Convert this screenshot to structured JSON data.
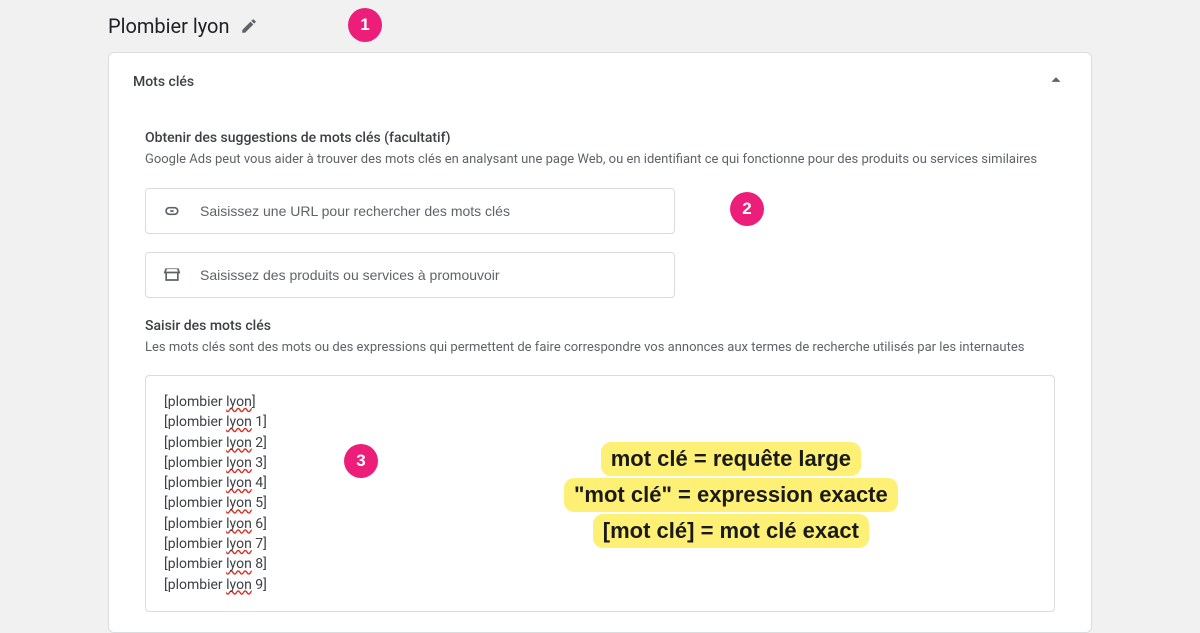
{
  "header": {
    "title": "Plombier lyon"
  },
  "card": {
    "title": "Mots clés"
  },
  "suggestions": {
    "title": "Obtenir des suggestions de mots clés (facultatif)",
    "desc": "Google Ads peut vous aider à trouver des mots clés en analysant une page Web, ou en identifiant ce qui fonctionne pour des produits ou services similaires",
    "url_placeholder": "Saisissez une URL pour rechercher des mots clés",
    "products_placeholder": "Saisissez des produits ou services à promouvoir"
  },
  "enter_keywords": {
    "title": "Saisir des mots clés",
    "desc": "Les mots clés sont des mots ou des expressions qui permettent de faire correspondre vos annonces aux termes de recherche utilisés par les internautes",
    "lines": [
      "[plombier lyon]",
      "[plombier lyon 1]",
      "[plombier lyon 2]",
      "[plombier lyon 3]",
      "[plombier lyon 4]",
      "[plombier lyon 5]",
      "[plombier lyon 6]",
      "[plombier lyon 7]",
      "[plombier lyon 8]",
      "[plombier lyon 9]"
    ]
  },
  "badges": {
    "1": "1",
    "2": "2",
    "3": "3"
  },
  "annotation": {
    "line1": "mot clé = requête large",
    "line2": "\"mot clé\" = expression exacte",
    "line3": "[mot clé] = mot clé exact"
  }
}
